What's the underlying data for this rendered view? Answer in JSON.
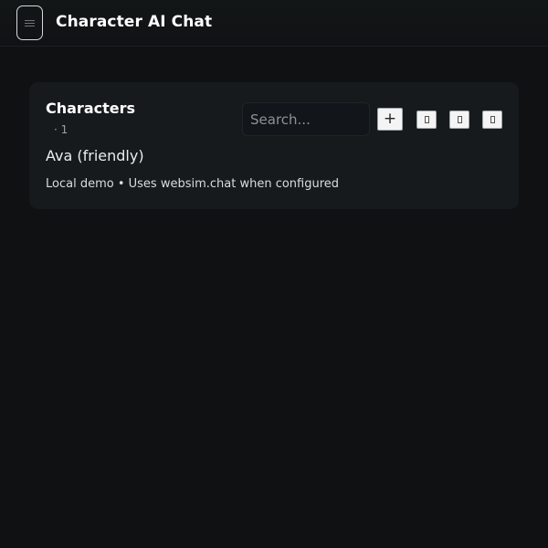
{
  "header": {
    "menu_icon": "hamburger-menu-icon",
    "title": "Character AI Chat"
  },
  "characters_panel": {
    "title": "Characters",
    "count": "· 1",
    "search": {
      "placeholder": "Search...",
      "value": ""
    },
    "actions": [
      {
        "label": "+",
        "icon": "plus-icon"
      },
      {
        "icon": "unknown-glyph-icon"
      },
      {
        "icon": "unknown-glyph-icon"
      },
      {
        "icon": "unknown-glyph-icon"
      }
    ],
    "items": [
      {
        "name": "Ava (friendly)",
        "meta": "Local demo • Uses websim.chat when configured"
      }
    ]
  },
  "colors": {
    "background": "#0f1112",
    "panel": "#161a1c",
    "text": "#e9edf1"
  }
}
